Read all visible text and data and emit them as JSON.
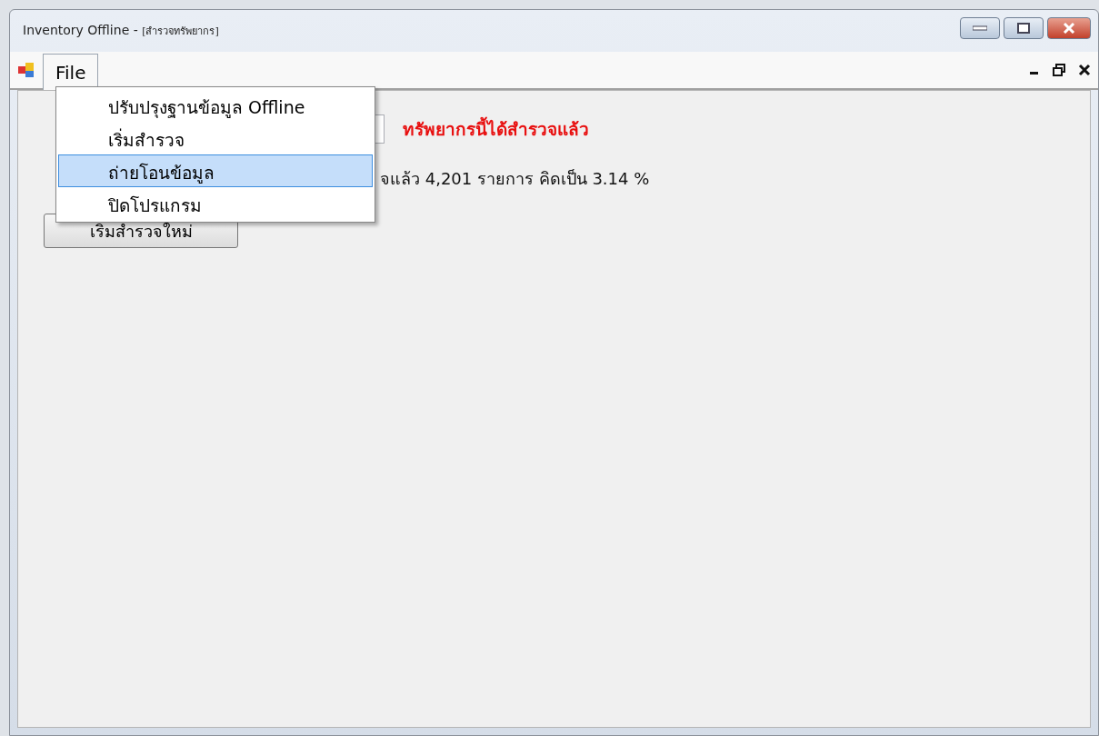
{
  "window": {
    "title": "Inventory Offline - ",
    "subtitle": "[สำรวจทรัพยากร]"
  },
  "menu_bar": {
    "items": [
      {
        "label": "File",
        "selected": true
      }
    ]
  },
  "file_menu": {
    "items": [
      {
        "label": "ปรับปรุงฐานข้อมูล Offline",
        "selected": false
      },
      {
        "label": "เริ่มสำรวจ",
        "selected": false
      },
      {
        "label": "ถ่ายโอนข้อมูล",
        "selected": true
      },
      {
        "label": "ปิดโปรแกรม",
        "selected": false
      }
    ]
  },
  "form": {
    "status_message": "ทรัพยากรนี้ได้สำรวจแล้ว",
    "summary": "จแล้ว 4,201 รายการ คิดเป็น 3.14 %",
    "restart_button": "เริ่มสำรวจใหม่"
  }
}
